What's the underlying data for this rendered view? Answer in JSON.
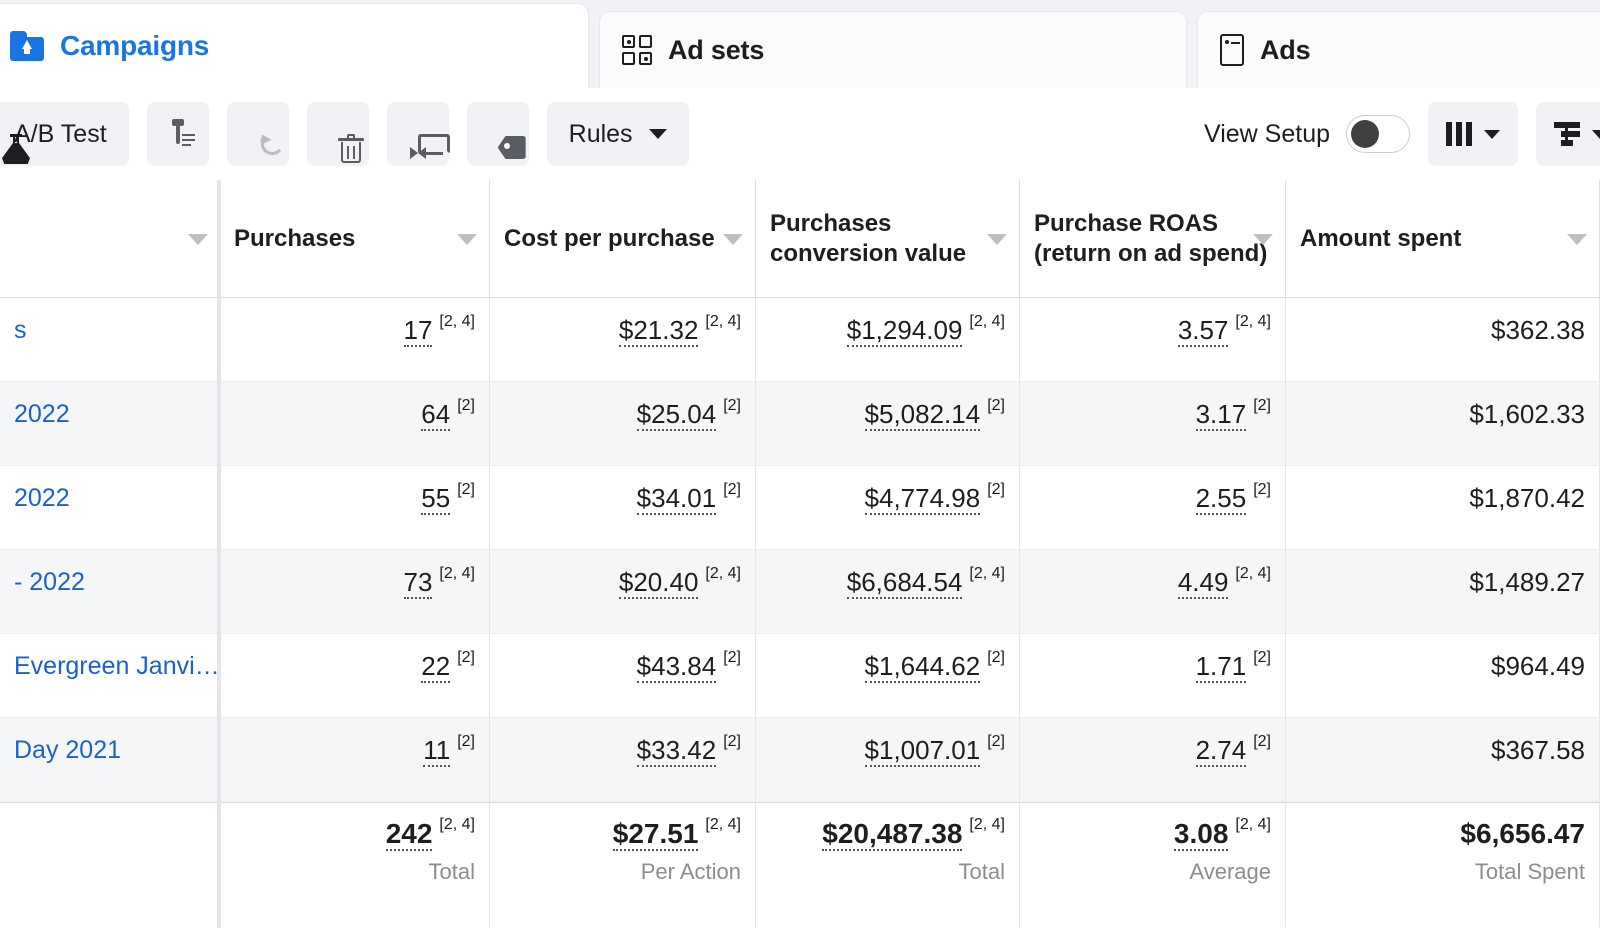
{
  "tabs": [
    {
      "label": "Campaigns",
      "icon": "campaign-folder-icon",
      "active": true
    },
    {
      "label": "Ad sets",
      "icon": "grid-icon",
      "active": false
    },
    {
      "label": "Ads",
      "icon": "ad-card-icon",
      "active": false
    }
  ],
  "toolbar": {
    "ab_test_label": "A/B Test",
    "ab_test_icon": "flask-icon",
    "duplicate_icon": "clipboard-icon",
    "undo_icon": "undo-icon",
    "delete_icon": "trash-icon",
    "move_icon": "move-arrows-icon",
    "tag_icon": "tag-icon",
    "rules_label": "Rules",
    "rules_caret_icon": "chevron-down-icon",
    "view_setup_label": "View Setup",
    "view_setup_on": false,
    "columns_icon": "columns-icon",
    "columns_caret_icon": "chevron-down-icon",
    "breakdown_icon": "breakdown-rows-icon",
    "breakdown_caret_icon": "chevron-down-icon"
  },
  "table": {
    "columns": [
      {
        "label": "",
        "key": "name",
        "sortable": true
      },
      {
        "label": "Purchases",
        "key": "purchases",
        "sortable": true
      },
      {
        "label": "Cost per purchase",
        "key": "cost_per_purchase",
        "sortable": true
      },
      {
        "label": "Purchases conversion value",
        "key": "purchases_conversion_value",
        "sortable": true
      },
      {
        "label": "Purchase ROAS (return on ad spend)",
        "key": "purchase_roas",
        "sortable": true
      },
      {
        "label": "Amount spent",
        "key": "amount_spent",
        "sortable": true
      }
    ],
    "rows": [
      {
        "name": "s",
        "purchases": "17",
        "purchases_fn": "[2, 4]",
        "cost_per_purchase": "$21.32",
        "cost_per_purchase_fn": "[2, 4]",
        "purchases_conversion_value": "$1,294.09",
        "purchases_conversion_value_fn": "[2, 4]",
        "purchase_roas": "3.57",
        "purchase_roas_fn": "[2, 4]",
        "amount_spent": "$362.38",
        "amount_spent_fn": ""
      },
      {
        "name": "2022",
        "purchases": "64",
        "purchases_fn": "[2]",
        "cost_per_purchase": "$25.04",
        "cost_per_purchase_fn": "[2]",
        "purchases_conversion_value": "$5,082.14",
        "purchases_conversion_value_fn": "[2]",
        "purchase_roas": "3.17",
        "purchase_roas_fn": "[2]",
        "amount_spent": "$1,602.33",
        "amount_spent_fn": ""
      },
      {
        "name": "2022",
        "purchases": "55",
        "purchases_fn": "[2]",
        "cost_per_purchase": "$34.01",
        "cost_per_purchase_fn": "[2]",
        "purchases_conversion_value": "$4,774.98",
        "purchases_conversion_value_fn": "[2]",
        "purchase_roas": "2.55",
        "purchase_roas_fn": "[2]",
        "amount_spent": "$1,870.42",
        "amount_spent_fn": ""
      },
      {
        "name": "- 2022",
        "purchases": "73",
        "purchases_fn": "[2, 4]",
        "cost_per_purchase": "$20.40",
        "cost_per_purchase_fn": "[2, 4]",
        "purchases_conversion_value": "$6,684.54",
        "purchases_conversion_value_fn": "[2, 4]",
        "purchase_roas": "4.49",
        "purchase_roas_fn": "[2, 4]",
        "amount_spent": "$1,489.27",
        "amount_spent_fn": ""
      },
      {
        "name": "Evergreen Janvi…",
        "purchases": "22",
        "purchases_fn": "[2]",
        "cost_per_purchase": "$43.84",
        "cost_per_purchase_fn": "[2]",
        "purchases_conversion_value": "$1,644.62",
        "purchases_conversion_value_fn": "[2]",
        "purchase_roas": "1.71",
        "purchase_roas_fn": "[2]",
        "amount_spent": "$964.49",
        "amount_spent_fn": ""
      },
      {
        "name": "Day 2021",
        "purchases": "11",
        "purchases_fn": "[2]",
        "cost_per_purchase": "$33.42",
        "cost_per_purchase_fn": "[2]",
        "purchases_conversion_value": "$1,007.01",
        "purchases_conversion_value_fn": "[2]",
        "purchase_roas": "2.74",
        "purchase_roas_fn": "[2]",
        "amount_spent": "$367.58",
        "amount_spent_fn": ""
      }
    ],
    "totals": {
      "name": "",
      "purchases": "242",
      "purchases_fn": "[2, 4]",
      "purchases_sub": "Total",
      "cost_per_purchase": "$27.51",
      "cost_per_purchase_fn": "[2, 4]",
      "cost_per_purchase_sub": "Per Action",
      "purchases_conversion_value": "$20,487.38",
      "purchases_conversion_value_fn": "[2, 4]",
      "purchases_conversion_value_sub": "Total",
      "purchase_roas": "3.08",
      "purchase_roas_fn": "[2, 4]",
      "purchase_roas_sub": "Average",
      "amount_spent": "$6,656.47",
      "amount_spent_fn": "",
      "amount_spent_sub": "Total Spent"
    }
  },
  "colors": {
    "accent": "#1b74e4",
    "link": "#1b5fd0",
    "text": "#1c1e21",
    "muted": "#8a8d91",
    "row_alt": "#f5f6f7",
    "chrome": "#f0f2f5",
    "border": "#dadde1"
  }
}
